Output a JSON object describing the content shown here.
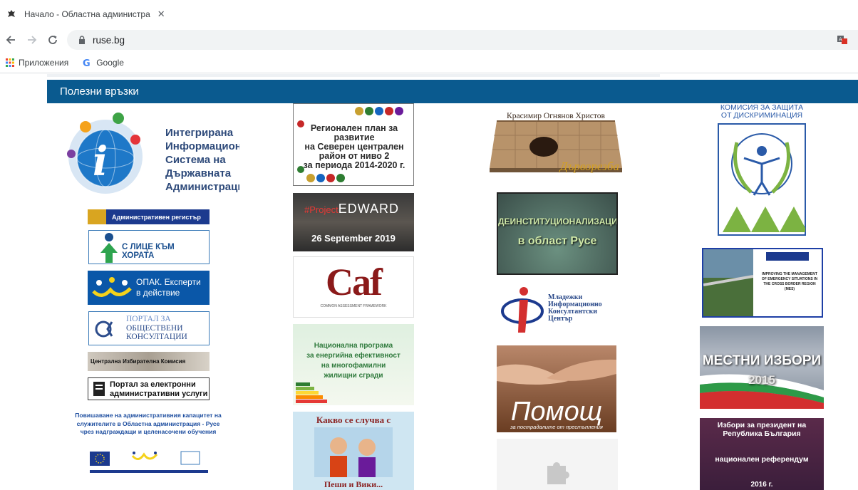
{
  "browser": {
    "tab_title": "Начало - Областна администра",
    "tab_close": "✕",
    "url": "ruse.bg",
    "bookmarks": [
      {
        "label": "Приложения",
        "icon": "apps-grid-icon"
      },
      {
        "label": "Google",
        "icon": "google-g-icon"
      }
    ]
  },
  "section": {
    "title": "Полезни връзки"
  },
  "col1": {
    "iisda": [
      "Интегрирана",
      "Информационна",
      "Система на",
      "Държавната",
      "Администрация"
    ],
    "adm_register": "Административен регистър",
    "face_to_people": "С ЛИЦЕ КЪМ ХОРАТА",
    "opak": [
      "ОПАК. Експерти",
      "в действие"
    ],
    "portal": [
      "ПОРТАЛ ЗА",
      "ОБЩЕСТВЕНИ",
      "КОНСУЛТАЦИИ"
    ],
    "cik": "Централна Избирателна Комисия",
    "eservices": [
      "Портал за електронни",
      "административни услуги"
    ],
    "capacity": [
      "Повишаване на административния капацитет на",
      "служителите в Областна администрация - Русе",
      "чрез надграждащи и целенасочени обучения"
    ]
  },
  "col2": {
    "regplan": [
      "Регионален план за развитие",
      "на Северен централен",
      "район от ниво 2",
      "за периода 2014-2020 г."
    ],
    "edward_tag": "#Project",
    "edward_name": "EDWARD",
    "edward_date": "26 September 2019",
    "caf": "Caf",
    "caf_sub": "COMMON ASSESSMENT FRAMEWORK",
    "energy": [
      "Национална програма",
      "за енергийна ефективност",
      "на многофамилни",
      "жилищни сгради"
    ],
    "kakvo_title": "Какво се случва с",
    "kakvo_bottom": "Пеши и Вики..."
  },
  "col3": {
    "stone_name": "Красимир Огнянов Христов",
    "stone_sub": "Дърворезба",
    "deinst": [
      "ДЕИНСТИТУЦИОНАЛИЗАЦИЯТА",
      "в област Русе"
    ],
    "mikc": [
      "Младежки",
      "Информационно",
      "Консултантски",
      "Център"
    ],
    "pomosht": "Помощ",
    "pomosht_sub": "за пострадалите от престъпления"
  },
  "col4": {
    "komisia": [
      "КОМИСИЯ ЗА ЗАЩИТА",
      "ОТ ДИСКРИМИНАЦИЯ"
    ],
    "bridge": "IMPROVING THE MANAGEMENT OF EMERGENCY SITUATIONS IN THE CROSS BORDER REGION (MES)",
    "izbori": "МЕСТНИ ИЗБОРИ",
    "izbori_year": "2015",
    "president": [
      "Избори за президент на",
      "Република България"
    ],
    "president_mid": "национален референдум",
    "president_year": "2016 г."
  },
  "colors": {
    "header_blue": "#0a5a8f",
    "page_bg": "#ffffff"
  }
}
